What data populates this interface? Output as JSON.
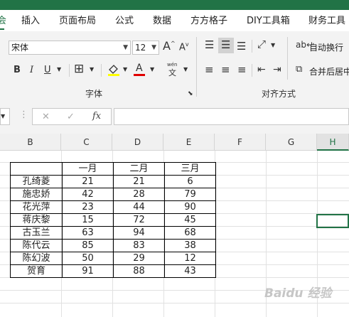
{
  "tabs": {
    "active": "会",
    "items": [
      "插入",
      "页面布局",
      "公式",
      "数据",
      "方方格子",
      "DIY工具箱",
      "财务工具"
    ]
  },
  "ribbon": {
    "font_name": "宋体",
    "font_size": "12",
    "grow_label": "A",
    "shrink_label": "A",
    "bold": "B",
    "italic": "I",
    "underline": "U",
    "phonetic": "wén",
    "font_group_label": "字体",
    "align_group_label": "对齐方式",
    "wrap_text": "自动换行",
    "merge_center": "合并后居中",
    "fill_color": "#ffff00",
    "font_color": "#e00000"
  },
  "formula_bar": {
    "cancel": "✕",
    "enter": "✓",
    "fx": "fx",
    "value": ""
  },
  "columns": [
    "B",
    "C",
    "D",
    "E",
    "F",
    "G",
    "H"
  ],
  "table": {
    "headers": [
      "",
      "一月",
      "二月",
      "三月"
    ],
    "rows": [
      [
        "孔绮菱",
        "21",
        "21",
        "6"
      ],
      [
        "施忠娇",
        "42",
        "28",
        "79"
      ],
      [
        "花光萍",
        "23",
        "44",
        "90"
      ],
      [
        "蒋庆黎",
        "15",
        "72",
        "45"
      ],
      [
        "古玉兰",
        "63",
        "94",
        "68"
      ],
      [
        "陈代云",
        "85",
        "83",
        "38"
      ],
      [
        "陈幻波",
        "50",
        "29",
        "12"
      ],
      [
        "贺育",
        "91",
        "88",
        "43"
      ]
    ]
  },
  "watermark": "Baidu 经验"
}
